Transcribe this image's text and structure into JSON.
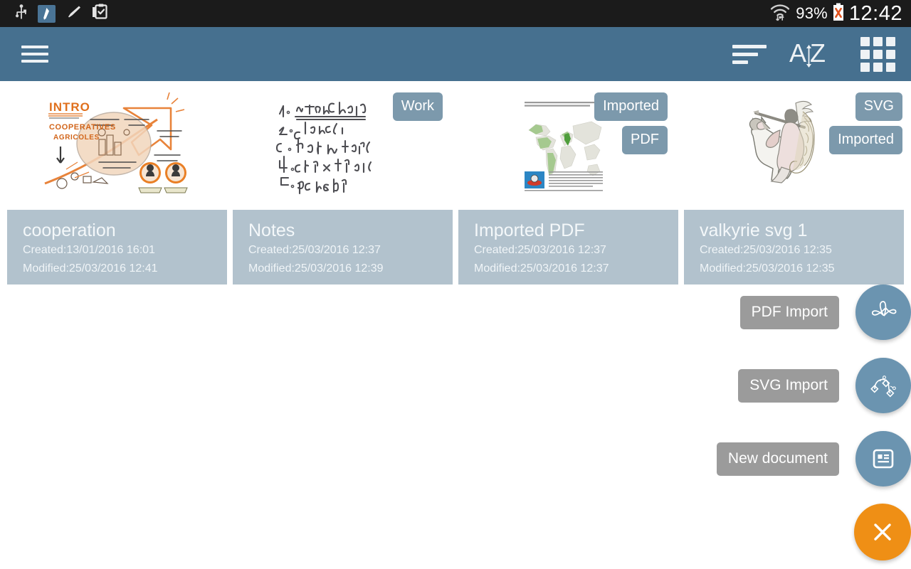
{
  "status_bar": {
    "icons": [
      "usb-icon",
      "stylus-pen-icon",
      "highlighter-pen-icon",
      "clipboard-check-icon",
      "wifi-icon"
    ],
    "battery_percent": "93%",
    "battery_icon": "battery-alert-icon",
    "time": "12:42"
  },
  "app_bar": {
    "menu_icon": "hamburger-menu-icon",
    "actions": [
      {
        "name": "sort-order-icon",
        "label": ""
      },
      {
        "name": "sort-alphabetical-icon",
        "label": "AZ"
      },
      {
        "name": "grid-view-icon",
        "label": ""
      }
    ]
  },
  "documents": [
    {
      "title": "cooperation",
      "created": "Created:13/01/2016 16:01",
      "modified": "Modified:25/03/2016 12:41",
      "thumbnail": "sketchnote-cooperatives-agricoles",
      "thumbnail_text": [
        "INTRO",
        "COOPERATIVES",
        "AGRICOLES"
      ],
      "tags": []
    },
    {
      "title": "Notes",
      "created": "Created:25/03/2016 12:37",
      "modified": "Modified:25/03/2016 12:39",
      "thumbnail": "handwritten-numbered-list",
      "thumbnail_text": [
        "1. Test thoroughly",
        "2. Release",
        "3. Do Marketing",
        "4. Analyze Numbers",
        "5. Repeat"
      ],
      "tags": [
        "Work"
      ]
    },
    {
      "title": "Imported PDF",
      "created": "Created:25/03/2016 12:37",
      "modified": "Modified:25/03/2016 12:37",
      "thumbnail": "world-map-document",
      "thumbnail_text": [],
      "tags": [
        "Imported",
        "PDF"
      ]
    },
    {
      "title": "valkyrie svg 1",
      "created": "Created:25/03/2016 12:35",
      "modified": "Modified:25/03/2016 12:35",
      "thumbnail": "valkyrie-on-horse-illustration",
      "thumbnail_text": [],
      "tags": [
        "SVG",
        "Imported"
      ]
    }
  ],
  "fab_menu": {
    "items": [
      {
        "label": "PDF Import",
        "icon": "pdf-acrobat-icon"
      },
      {
        "label": "SVG Import",
        "icon": "bezier-path-icon"
      },
      {
        "label": "New document",
        "icon": "new-document-icon"
      }
    ],
    "close": {
      "label": "",
      "icon": "close-x-icon"
    }
  },
  "colors": {
    "app_bar": "#46708f",
    "status_bar": "#1b1b1b",
    "card": "#b2c2cd",
    "tag": "#7c99ac",
    "fab": "#6b94b0",
    "fab_close": "#ef8f15",
    "fab_label": "#9b9b9b"
  }
}
